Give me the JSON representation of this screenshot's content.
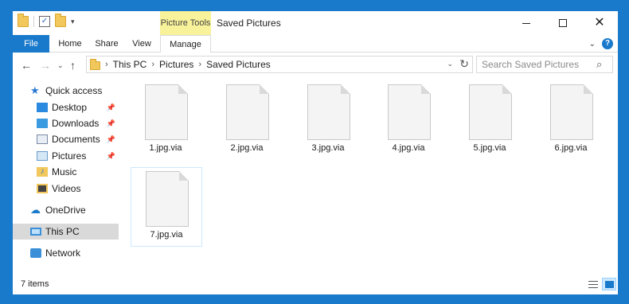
{
  "window": {
    "title": "Saved Pictures",
    "context_tab": "Picture Tools",
    "minimize_glyph": "—",
    "maximize_glyph": "☐",
    "close_glyph": "✕"
  },
  "ribbon": {
    "tabs": [
      {
        "label": "File"
      },
      {
        "label": "Home"
      },
      {
        "label": "Share"
      },
      {
        "label": "View"
      },
      {
        "label": "Manage"
      }
    ]
  },
  "address": {
    "crumbs": [
      "This PC",
      "Pictures",
      "Saved Pictures"
    ]
  },
  "search": {
    "placeholder": "Search Saved Pictures"
  },
  "nav": {
    "quick_access": "Quick access",
    "items": [
      {
        "label": "Desktop",
        "pinned": true
      },
      {
        "label": "Downloads",
        "pinned": true
      },
      {
        "label": "Documents",
        "pinned": true
      },
      {
        "label": "Pictures",
        "pinned": true
      },
      {
        "label": "Music",
        "pinned": false
      },
      {
        "label": "Videos",
        "pinned": false
      }
    ],
    "onedrive": "OneDrive",
    "this_pc": "This PC",
    "network": "Network"
  },
  "files": [
    {
      "name": "1.jpg.via"
    },
    {
      "name": "2.jpg.via"
    },
    {
      "name": "3.jpg.via"
    },
    {
      "name": "4.jpg.via"
    },
    {
      "name": "5.jpg.via"
    },
    {
      "name": "6.jpg.via"
    },
    {
      "name": "7.jpg.via",
      "selected": true
    }
  ],
  "status": {
    "item_count": "7 items"
  },
  "colors": {
    "accent": "#1979ca",
    "context_tab_bg": "#f8f29a",
    "selection_bg": "#d9d9d9"
  },
  "icons": {
    "back": "arrow-left-icon",
    "forward": "arrow-right-icon",
    "up": "arrow-up-icon",
    "refresh": "refresh-icon",
    "search": "search-icon",
    "help": "help-icon",
    "pin": "pin-icon"
  }
}
